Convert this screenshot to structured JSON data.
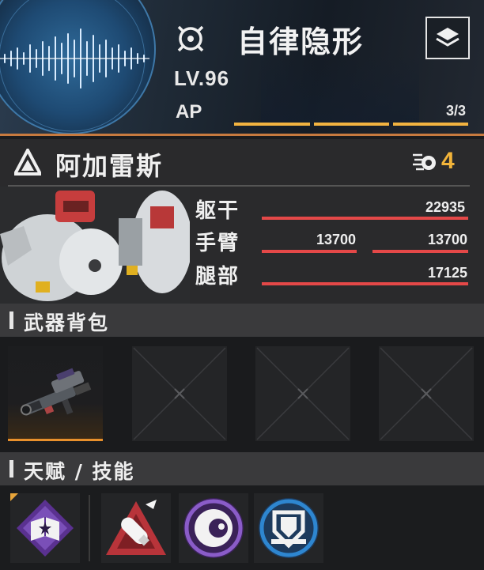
{
  "header": {
    "mode_title": "自律隐形",
    "level": "LV.96",
    "ap_label": "AP",
    "ap_value": "3/3",
    "ap_current": 3,
    "ap_max": 3,
    "accent": "#f2b340",
    "icons": {
      "mode": "crosshair-icon",
      "layers": "layers-icon",
      "scan": "audio-waveform-icon"
    }
  },
  "mech": {
    "name": "阿加雷斯",
    "class_icon": "triangle-emblem-icon",
    "badge_icon": "missile-icon",
    "badge_value": "4",
    "parts": [
      {
        "label": "躯干",
        "value": "22935",
        "fill": 1.0
      },
      {
        "label": "手臂",
        "left_value": "13700",
        "right_value": "13700",
        "left_fill": 1.0,
        "right_fill": 1.0
      },
      {
        "label": "腿部",
        "value": "17125",
        "fill": 1.0
      }
    ],
    "bar_color": "#e44848"
  },
  "weapons": {
    "title": "武器背包",
    "slots": [
      {
        "state": "filled",
        "icon": "rifle-icon"
      },
      {
        "state": "empty",
        "icon": "empty-slot-icon"
      },
      {
        "state": "empty",
        "icon": "empty-slot-icon"
      },
      {
        "state": "empty",
        "icon": "empty-slot-icon"
      }
    ]
  },
  "skills": {
    "title": "天赋 / 技能",
    "items": [
      {
        "icon": "talent-book-icon",
        "color": "#6a3fa0"
      },
      {
        "icon": "missile-strike-icon",
        "color": "#c0393b"
      },
      {
        "icon": "eye-orb-icon",
        "color": "#7a4bb8"
      },
      {
        "icon": "armor-shield-icon",
        "color": "#2e7fc4"
      }
    ]
  }
}
